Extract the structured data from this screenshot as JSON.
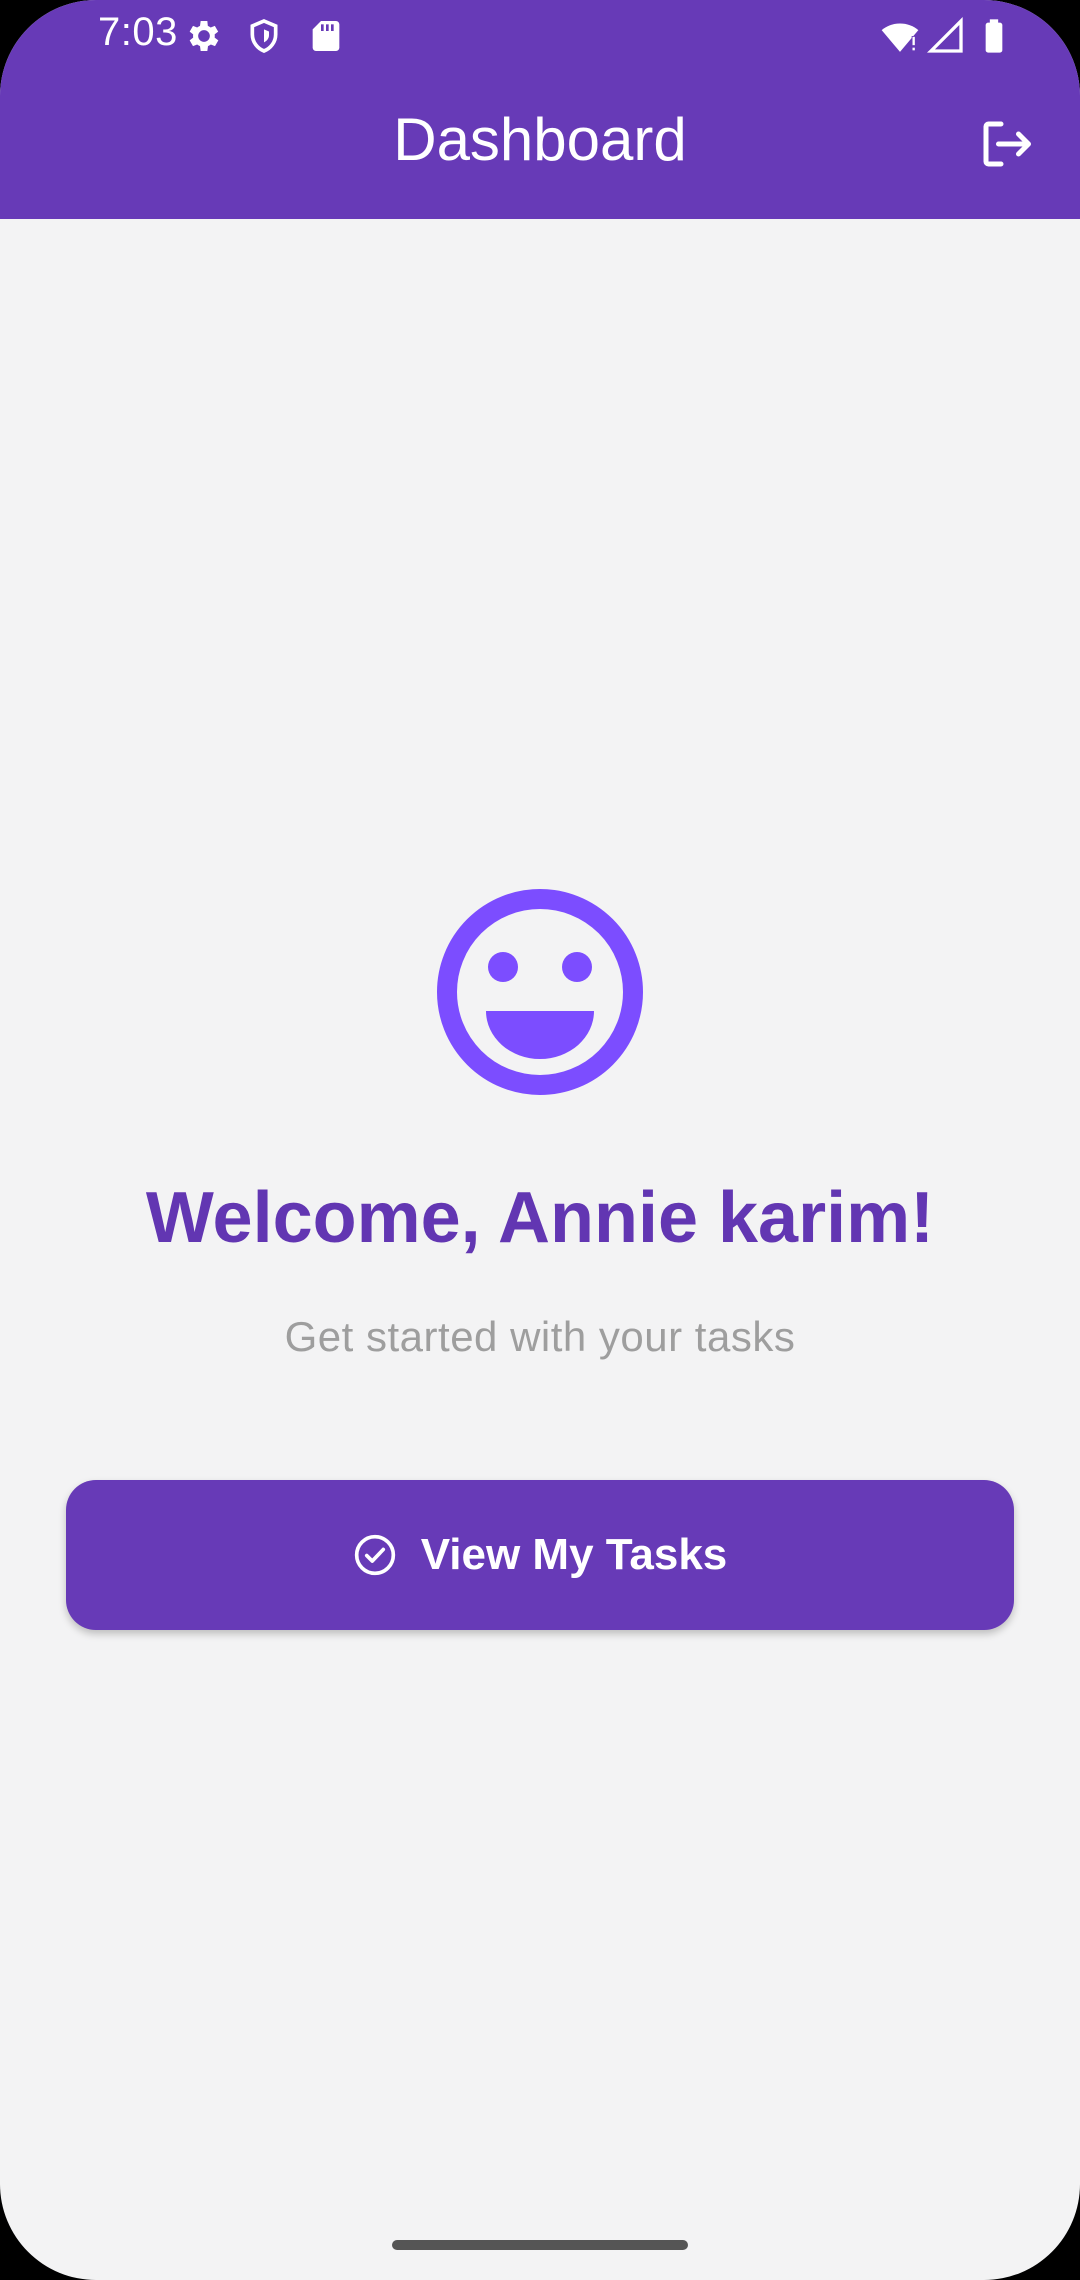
{
  "status_bar": {
    "time": "7:03",
    "left_icons": [
      "gear-icon",
      "shield-icon",
      "sd-card-icon"
    ],
    "right_icons": [
      "wifi-alert-icon",
      "cell-signal-icon",
      "battery-icon"
    ]
  },
  "app_bar": {
    "title": "Dashboard",
    "action_icon": "logout-icon"
  },
  "main": {
    "hero_icon": "smiley-face-icon",
    "welcome_text": "Welcome, Annie karim!",
    "subtitle": "Get started with your tasks",
    "primary_button": {
      "icon": "check-circle-icon",
      "label": "View My Tasks"
    }
  },
  "colors": {
    "primary": "#673AB7",
    "accent": "#7C4DFF",
    "background": "#F3F3F4",
    "subtitle_text": "#9E9E9E"
  }
}
